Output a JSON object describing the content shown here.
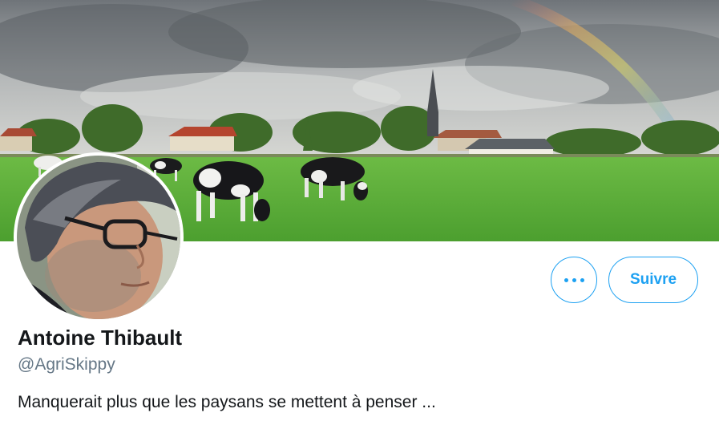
{
  "profile": {
    "display_name": "Antoine Thibault",
    "handle": "@AgriSkippy",
    "bio": "Manquerait plus que les paysans se mettent à penser ..."
  },
  "actions": {
    "more_icon": "more-horizontal-icon",
    "follow_label": "Suivre"
  },
  "colors": {
    "accent": "#1da1f2",
    "name_text": "#14171a",
    "secondary_text": "#657786"
  }
}
